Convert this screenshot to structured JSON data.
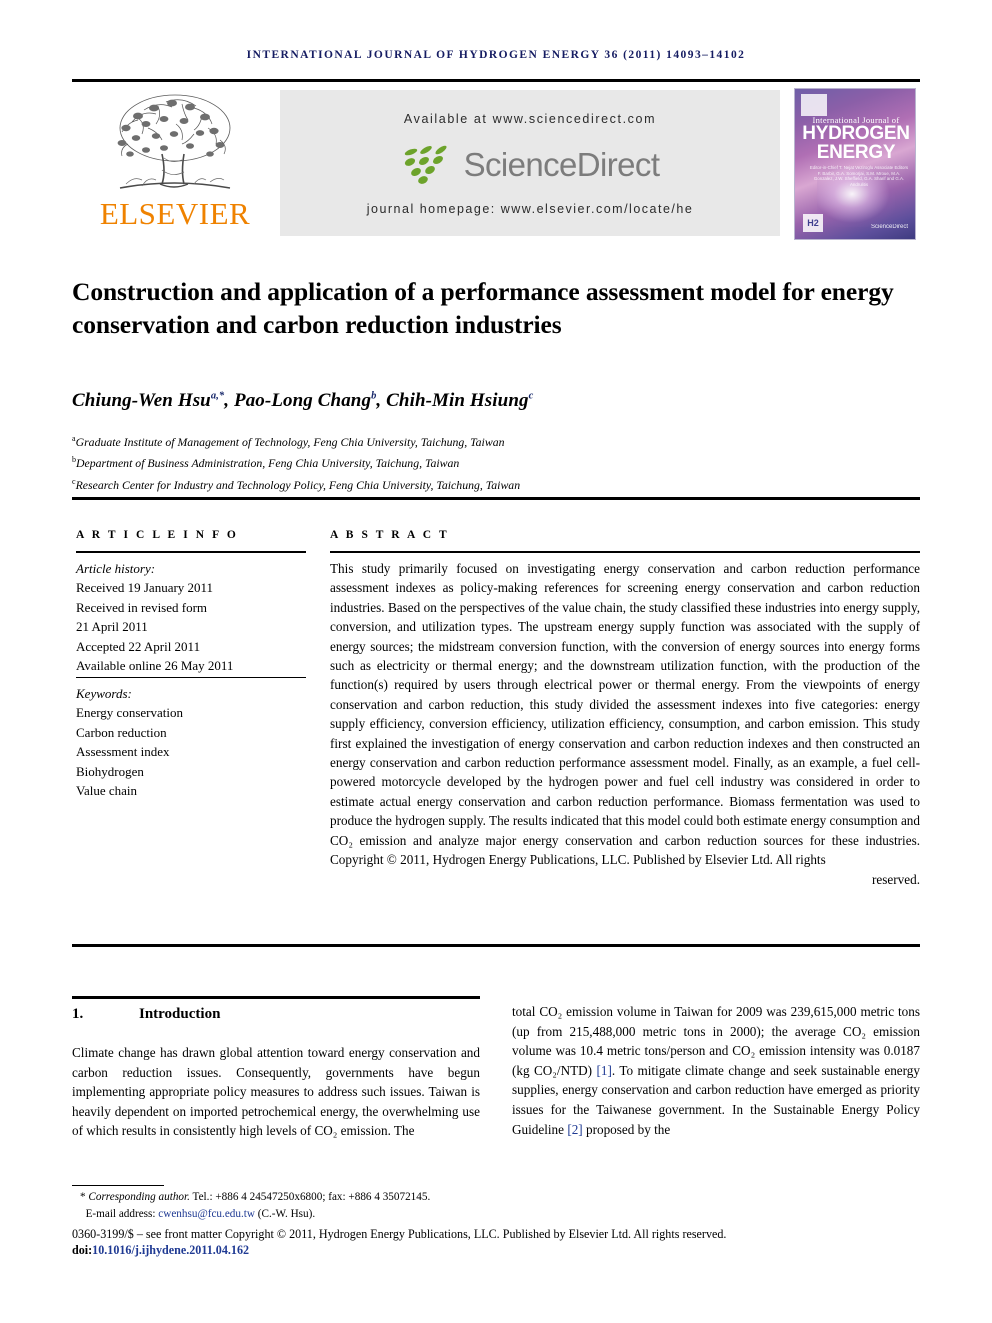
{
  "running_head": "International Journal of Hydrogen Energy 36 (2011) 14093–14102",
  "masthead": {
    "publisher_name": "ELSEVIER",
    "available_at": "Available at www.sciencedirect.com",
    "sciencedirect_wordmark": "ScienceDirect",
    "journal_homepage": "journal homepage: www.elsevier.com/locate/he",
    "cover": {
      "line_small": "International Journal of",
      "line_big_1": "HYDROGEN",
      "line_big_2": "ENERGY",
      "editors": "Editor-in-Chief T. Nejat Veziroglu    Associate Editors F. Barbir, G.A. Somorjai, S.M. Mroue, M.A. Gonzalez, J.W. Sheffield, G.A. Sharif and G.A. Andrulitis",
      "badge": "H2",
      "sciencedirect_mark": "ScienceDirect"
    }
  },
  "title": "Construction and application of a performance assessment model for energy conservation and carbon reduction industries",
  "authors": [
    {
      "name": "Chiung-Wen Hsu",
      "marks": "a,*"
    },
    {
      "name": "Pao-Long Chang",
      "marks": "b"
    },
    {
      "name": "Chih-Min Hsiung",
      "marks": "c"
    }
  ],
  "affiliations": [
    {
      "mark": "a",
      "text": "Graduate Institute of Management of Technology, Feng Chia University, Taichung, Taiwan"
    },
    {
      "mark": "b",
      "text": "Department of Business Administration, Feng Chia University, Taichung, Taiwan"
    },
    {
      "mark": "c",
      "text": "Research Center for Industry and Technology Policy, Feng Chia University, Taichung, Taiwan"
    }
  ],
  "article_info": {
    "heading": "A R T I C L E   I N F O",
    "history_label": "Article history:",
    "history": [
      "Received 19 January 2011",
      "Received in revised form",
      "21 April 2011",
      "Accepted 22 April 2011",
      "Available online 26 May 2011"
    ],
    "keywords_label": "Keywords:",
    "keywords": [
      "Energy conservation",
      "Carbon reduction",
      "Assessment index",
      "Biohydrogen",
      "Value chain"
    ]
  },
  "abstract": {
    "heading": "A B S T R A C T",
    "body": "This study primarily focused on investigating energy conservation and carbon reduction performance assessment indexes as policy-making references for screening energy conservation and carbon reduction industries. Based on the perspectives of the value chain, the study classified these industries into energy supply, conversion, and utilization types. The upstream energy supply function was associated with the supply of energy sources; the midstream conversion function, with the conversion of energy sources into energy forms such as electricity or thermal energy; and the downstream utilization function, with the production of the function(s) required by users through electrical power or thermal energy. From the viewpoints of energy conservation and carbon reduction, this study divided the assessment indexes into five categories: energy supply efficiency, conversion efficiency, utilization efficiency, consumption, and carbon emission. This study first explained the investigation of energy conservation and carbon reduction indexes and then constructed an energy conservation and carbon reduction performance assessment model. Finally, as an example, a fuel cell-powered motorcycle developed by the hydrogen power and fuel cell industry was considered in order to estimate actual energy conservation and carbon reduction performance. Biomass fermentation was used to produce the hydrogen supply. The results indicated that this model could both estimate energy consumption and CO₂ emission and analyze major energy conservation and carbon reduction sources for these industries. Copyright © 2011, Hydrogen Energy Publications, LLC. Published by Elsevier Ltd. All rights",
    "body_last_line": "reserved."
  },
  "section": {
    "number": "1.",
    "title": "Introduction",
    "left_column": "Climate change has drawn global attention toward energy conservation and carbon reduction issues. Consequently, governments have begun implementing appropriate policy measures to address such issues. Taiwan is heavily dependent on imported petrochemical energy, the overwhelming use of which results in consistently high levels of CO₂ emission. The",
    "right_column_parts": [
      {
        "text": "total CO₂ emission volume in Taiwan for 2009 was 239,615,000 metric tons (up from 215,488,000 metric tons in 2000); the average CO₂ emission volume was 10.4 metric tons/person and CO₂ emission intensity was 0.0187 (kg CO₂/NTD) ",
        "type": "text"
      },
      {
        "text": "[1]",
        "type": "cite"
      },
      {
        "text": ". To mitigate climate change and seek sustainable energy supplies, energy conservation and carbon reduction have emerged as priority issues for the Taiwanese government. In the Sustainable Energy Policy Guideline ",
        "type": "text"
      },
      {
        "text": "[2]",
        "type": "cite"
      },
      {
        "text": " proposed by the",
        "type": "text"
      }
    ]
  },
  "footnotes": {
    "corresponding_lead": "Corresponding author.",
    "corresponding_rest": " Tel.: +886 4 24547250x6800; fax: +886 4 35072145.",
    "email_label": "E-mail address: ",
    "email": "cwenhsu@fcu.edu.tw",
    "email_suffix": " (C.-W. Hsu).",
    "front_matter": "0360-3199/$ – see front matter Copyright © 2011, Hydrogen Energy Publications, LLC. Published by Elsevier Ltd. All rights reserved.",
    "doi_label": "doi:",
    "doi_value": "10.1016/j.ijhydene.2011.04.162"
  },
  "colors": {
    "running_head": "#151c62",
    "elsevier_orange": "#ef8200",
    "link_blue": "#1f3a93",
    "sciencedirect_green": "#6da32b",
    "sciencedirect_gray": "#7c7c7c"
  }
}
